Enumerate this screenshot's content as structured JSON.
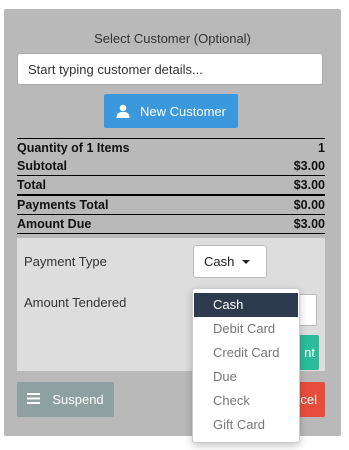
{
  "customer": {
    "title": "Select Customer (Optional)",
    "search_placeholder": "Start typing customer details...",
    "new_customer_label": "New Customer"
  },
  "totals": [
    {
      "label": "Quantity of 1 Items",
      "value": "1"
    },
    {
      "label": "Subtotal",
      "value": "$3.00"
    },
    {
      "label": "Total",
      "value": "$3.00"
    },
    {
      "label": "Payments Total",
      "value": "$0.00"
    },
    {
      "label": "Amount Due",
      "value": "$3.00"
    }
  ],
  "payment": {
    "type_label": "Payment Type",
    "type_selected": "Cash",
    "tendered_label": "Amount Tendered",
    "add_button_partial": "nt",
    "options": [
      "Cash",
      "Debit Card",
      "Credit Card",
      "Due",
      "Check",
      "Gift Card"
    ]
  },
  "actions": {
    "suspend_label": "Suspend",
    "cancel_partial": "cel"
  },
  "colors": {
    "panel_bg": "#b9b9b9",
    "primary": "#3b98dd",
    "success": "#2bbd9b",
    "danger": "#e74c3c",
    "suspend": "#8fa0a0",
    "dropdown_active": "#2e3b4e"
  },
  "icons": {
    "new_customer": "user-icon",
    "suspend": "list-icon",
    "select_caret": "caret-down-icon"
  }
}
